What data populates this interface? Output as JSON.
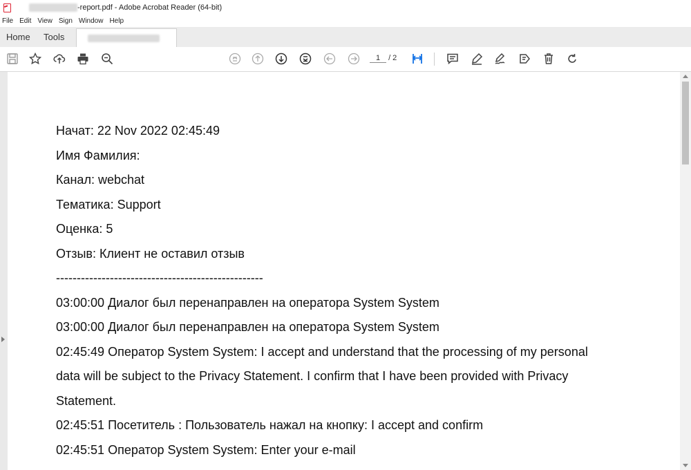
{
  "window": {
    "title": "-report.pdf - Adobe Acrobat Reader (64-bit)"
  },
  "menu": [
    "File",
    "Edit",
    "View",
    "Sign",
    "Window",
    "Help"
  ],
  "tabs": {
    "home": "Home",
    "tools": "Tools"
  },
  "toolbar": {
    "page_current": "1",
    "page_total": "/ 2"
  },
  "icons": {
    "save": "save-icon",
    "bookmark": "star-icon",
    "upload": "cloud-upload-icon",
    "print": "print-icon",
    "zoom": "zoom-out-icon",
    "first": "first-page-icon",
    "prev": "page-up-icon",
    "next": "page-down-icon",
    "last": "last-page-icon",
    "back": "back-icon",
    "forward": "forward-icon",
    "fit": "fit-page-icon",
    "comment": "comment-icon",
    "highlight": "highlight-icon",
    "sign": "sign-icon",
    "stamp": "stamp-icon",
    "delete": "trash-icon",
    "rotate": "rotate-icon"
  },
  "document": {
    "lines": [
      "Начат: 22 Nov 2022 02:45:49",
      "Имя Фамилия:",
      "Канал: webchat",
      "Тематика: Support",
      "Оценка: 5",
      "Отзыв: Клиент не оставил отзыв",
      "--------------------------------------------------",
      "03:00:00 Диалог был перенаправлен на оператора System System",
      "03:00:00 Диалог был перенаправлен на оператора System System",
      "02:45:49 Оператор System System: I accept and understand that the processing of my personal",
      "data will be subject to the  Privacy Statement. I confirm that I have been provided with  Privacy",
      "Statement.",
      "02:45:51 Посетитель  : Пользователь нажал на кнопку: I accept and confirm",
      "02:45:51 Оператор System System: Enter your e-mail"
    ]
  }
}
